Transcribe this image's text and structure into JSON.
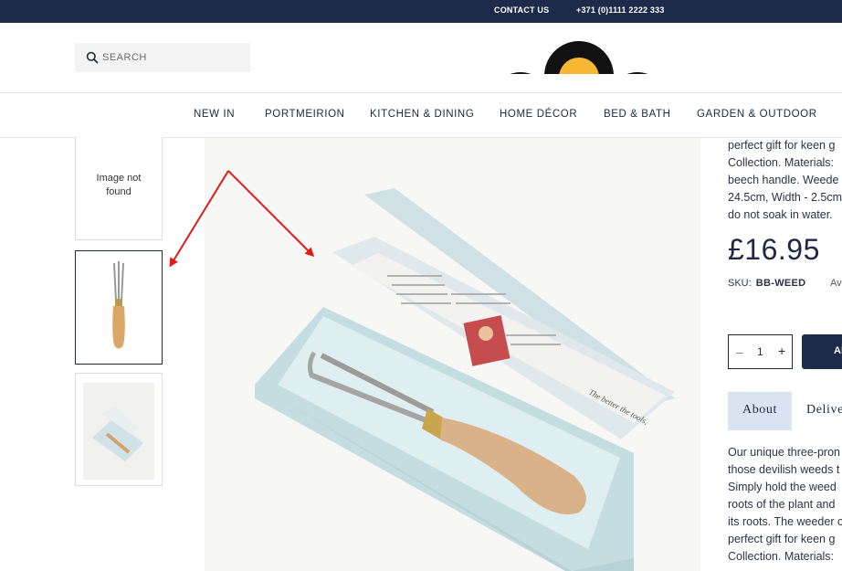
{
  "topbar": {
    "contact_label": "CONTACT US",
    "phone": "+371 (0)1111 2222 333"
  },
  "search": {
    "placeholder": "SEARCH"
  },
  "nav": {
    "items": [
      "NEW IN",
      "PORTMEIRION",
      "KITCHEN & DINING",
      "HOME DÉCOR",
      "BED & BATH",
      "GARDEN & OUTDOOR"
    ]
  },
  "thumbnails": {
    "missing_text": "Image not found"
  },
  "product": {
    "desc_top": [
      "perfect gift for keen g",
      "Collection. Materials:",
      "beech handle. Weede",
      "24.5cm, Width - 2.5cm",
      "do not soak in water."
    ],
    "price": "£16.95",
    "sku_label": "SKU:",
    "sku_value": "BB-WEED",
    "availability": "Av",
    "quantity": "1",
    "minus_symbol": "–",
    "plus_symbol": "+",
    "add_label": "AD",
    "tabs": [
      "About",
      "Delive"
    ],
    "desc_bottom": [
      "Our unique three-pron",
      "those devilish weeds t",
      "Simply hold the weed",
      "roots of the plant and",
      "its roots. The weeder c",
      "perfect gift for keen g",
      "Collection. Materials:"
    ]
  },
  "colors": {
    "navy": "#1e2a4a",
    "tab_active": "#d9e3f2",
    "annotation_red": "#e01b1b",
    "logo_yellow": "#f7b733"
  },
  "icons": {
    "search": "search-icon",
    "logo": "logo-graphic"
  }
}
